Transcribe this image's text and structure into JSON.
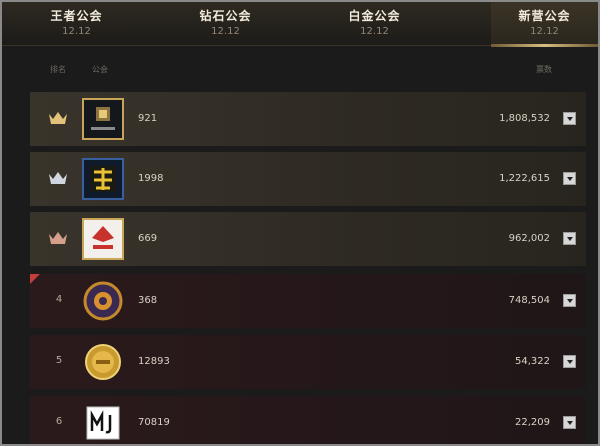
{
  "tabs": [
    {
      "name": "王者公会",
      "date": "12.12",
      "active": false
    },
    {
      "name": "钻石公会",
      "date": "12.12",
      "active": false
    },
    {
      "name": "白金公会",
      "date": "12.12",
      "active": false
    },
    {
      "name": "新营公会",
      "date": "12.12",
      "active": true
    }
  ],
  "columns": {
    "rank": "排名",
    "guild": "公会",
    "score": "票数"
  },
  "rows": [
    {
      "rank": "1",
      "crown": "crown-gold-icon",
      "emblem": "dark-badge-emblem",
      "guild_id": "921",
      "score": "1,808,532"
    },
    {
      "rank": "2",
      "crown": "crown-silver-icon",
      "emblem": "gold-character-emblem",
      "guild_id": "1998",
      "score": "1,222,615"
    },
    {
      "rank": "3",
      "crown": "crown-bronze-icon",
      "emblem": "red-white-emblem",
      "guild_id": "669",
      "score": "962,002"
    },
    {
      "rank": "4",
      "crown": null,
      "emblem": "round-ornate-emblem",
      "guild_id": "368",
      "score": "748,504"
    },
    {
      "rank": "5",
      "crown": null,
      "emblem": "gold-coin-emblem",
      "guild_id": "12893",
      "score": "54,322"
    },
    {
      "rank": "6",
      "crown": null,
      "emblem": "mj-logo-emblem",
      "guild_id": "70819",
      "score": "22,209"
    }
  ],
  "colors": {
    "accent_gold": "#d8bd80",
    "crown_gold": "#e2c27a",
    "crown_silver": "#cfd6e0",
    "crown_bronze": "#d4a08c",
    "red_marker": "#c43d3d"
  }
}
